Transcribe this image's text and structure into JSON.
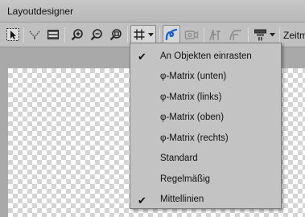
{
  "window": {
    "title": "Layoutdesigner"
  },
  "toolbar": {
    "buttons": [
      {
        "name": "select-frame-button",
        "icon": "select-frame-icon"
      },
      {
        "name": "funnel-button",
        "icon": "funnel-icon"
      },
      {
        "name": "panel-button",
        "icon": "panel-icon"
      },
      {
        "name": "zoom-in-button",
        "icon": "zoom-in-icon"
      },
      {
        "name": "zoom-out-button",
        "icon": "zoom-out-icon"
      },
      {
        "name": "zoom-fit-button",
        "icon": "zoom-fit-icon"
      },
      {
        "name": "grid-button",
        "icon": "grid-icon"
      },
      {
        "name": "snap-button",
        "icon": "snap-icon"
      },
      {
        "name": "camera-button",
        "icon": "camera-icon"
      },
      {
        "name": "curve-button",
        "icon": "curve-icon"
      },
      {
        "name": "curve-alt-button",
        "icon": "curve-alt-icon"
      },
      {
        "name": "format-button",
        "icon": "format-icon"
      }
    ],
    "truncated_label": "Zeitm"
  },
  "grid_menu": {
    "items": [
      {
        "label": "An Objekten einrasten",
        "checked": true
      },
      {
        "label": "φ-Matrix (unten)",
        "checked": false
      },
      {
        "label": "φ-Matrix (links)",
        "checked": false
      },
      {
        "label": "φ-Matrix (oben)",
        "checked": false
      },
      {
        "label": "φ-Matrix (rechts)",
        "checked": false
      },
      {
        "label": "Standard",
        "checked": false
      },
      {
        "label": "Regelmäßig",
        "checked": false
      },
      {
        "label": "Mittellinien",
        "checked": true
      }
    ]
  },
  "colors": {
    "accent": "#1560c8"
  }
}
